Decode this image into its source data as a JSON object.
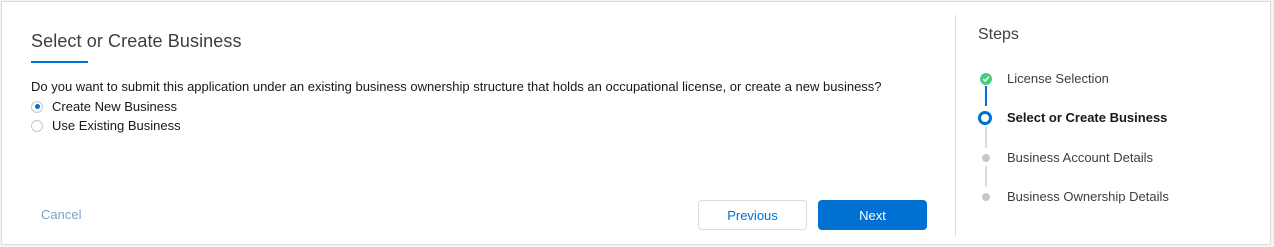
{
  "form": {
    "title": "Select or Create Business",
    "question": "Do you want to submit this application under an existing business ownership structure that holds an occupational license, or create a new business?",
    "options": [
      {
        "label": "Create New Business",
        "selected": true
      },
      {
        "label": "Use Existing Business",
        "selected": false
      }
    ],
    "cancel_label": "Cancel",
    "previous_label": "Previous",
    "next_label": "Next"
  },
  "steps": {
    "title": "Steps",
    "items": [
      {
        "label": "License Selection",
        "status": "complete"
      },
      {
        "label": "Select or Create Business",
        "status": "current"
      },
      {
        "label": "Business Account Details",
        "status": "pending"
      },
      {
        "label": "Business Ownership Details",
        "status": "pending"
      }
    ]
  },
  "colors": {
    "brand": "#0070d2",
    "success": "#4bca81",
    "pending": "#c9c7c5"
  }
}
